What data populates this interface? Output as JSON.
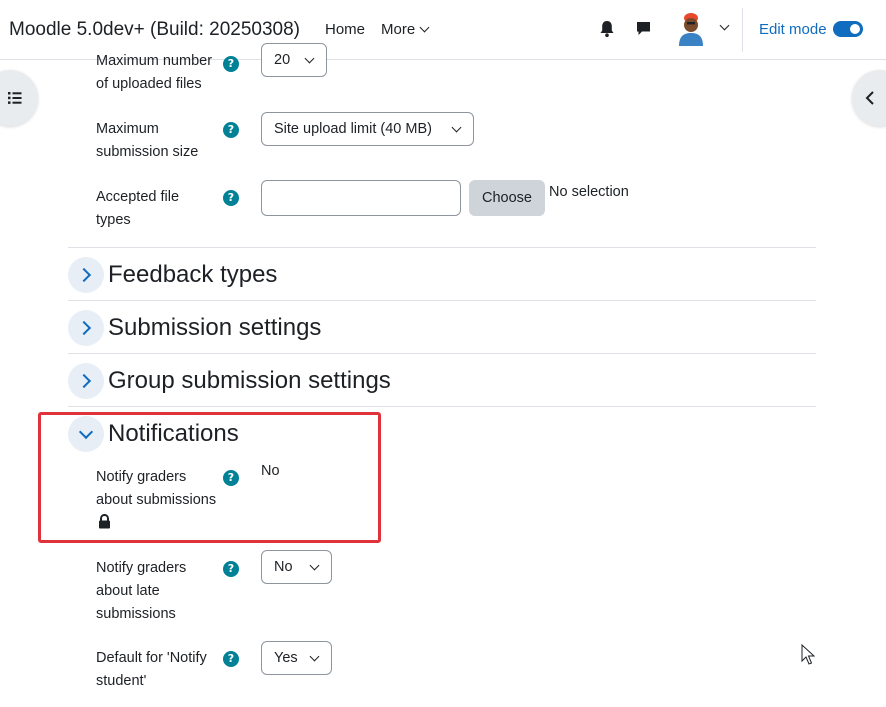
{
  "navbar": {
    "site_name": "Moodle 5.0dev+ (Build: 20250308)",
    "home": "Home",
    "more": "More",
    "edit_mode": "Edit mode"
  },
  "form": {
    "max_files_label": "Maximum number of uploaded files",
    "max_files_value": "20",
    "max_size_label_1": "Maximum",
    "max_size_label_2": "submission size",
    "max_size_value": "Site upload limit (40 MB)",
    "file_types_label_1": "Accepted file",
    "file_types_label_2": "types",
    "choose_button": "Choose",
    "no_selection": "No selection"
  },
  "sections": {
    "feedback": "Feedback types",
    "submission": "Submission settings",
    "group": "Group submission settings",
    "notifications": "Notifications"
  },
  "notifications": {
    "notify_graders_label_1": "Notify graders",
    "notify_graders_label_2": "about submissions",
    "notify_graders_value": "No",
    "notify_late_label_1": "Notify graders",
    "notify_late_label_2": "about late",
    "notify_late_label_3": "submissions",
    "notify_late_value": "No",
    "default_notify_label_1": "Default for 'Notify",
    "default_notify_label_2": "student'",
    "default_notify_value": "Yes"
  },
  "help_glyph": "?",
  "colors": {
    "accent": "#0f6cbf",
    "help": "#008196",
    "highlight": "#e0323a"
  }
}
